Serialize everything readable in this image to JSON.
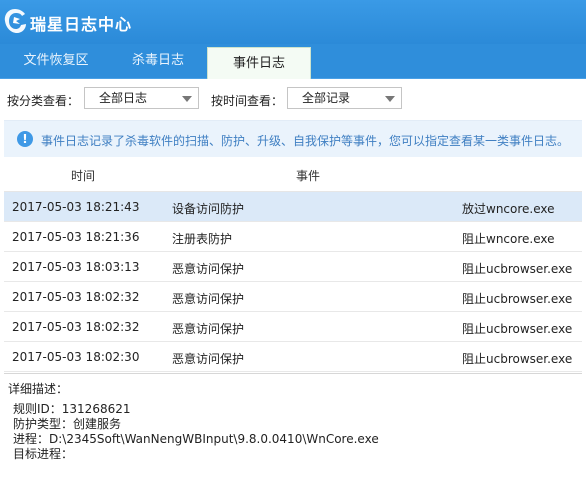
{
  "app": {
    "title": "瑞星日志中心"
  },
  "tabs": [
    {
      "label": "文件恢复区"
    },
    {
      "label": "杀毒日志"
    },
    {
      "label": "事件日志"
    }
  ],
  "filters": {
    "category_label": "按分类查看：",
    "category_value": "全部日志",
    "time_label": "按时间查看：",
    "time_value": "全部记录"
  },
  "notice": {
    "text": "事件日志记录了杀毒软件的扫描、防护、升级、自我保护等事件，您可以指定查看某一类事件日志。"
  },
  "table": {
    "columns": [
      "时间",
      "事件"
    ],
    "rows": [
      {
        "time": "2017-05-03 18:21:43",
        "event": "设备访问防护",
        "action": "放过wncore.exe"
      },
      {
        "time": "2017-05-03 18:21:36",
        "event": "注册表防护",
        "action": "阻止wncore.exe"
      },
      {
        "time": "2017-05-03 18:03:13",
        "event": "恶意访问保护",
        "action": "阻止ucbrowser.exe"
      },
      {
        "time": "2017-05-03 18:02:32",
        "event": "恶意访问保护",
        "action": "阻止ucbrowser.exe"
      },
      {
        "time": "2017-05-03 18:02:32",
        "event": "恶意访问保护",
        "action": "阻止ucbrowser.exe"
      },
      {
        "time": "2017-05-03 18:02:30",
        "event": "恶意访问保护",
        "action": "阻止ucbrowser.exe"
      }
    ]
  },
  "detail": {
    "title": "详细描述：",
    "lines": [
      "规则ID：131268621",
      "防护类型：创建服务",
      "进程：D:\\2345Soft\\WanNengWBInput\\9.8.0.0410\\WnCore.exe",
      "目标进程："
    ]
  }
}
